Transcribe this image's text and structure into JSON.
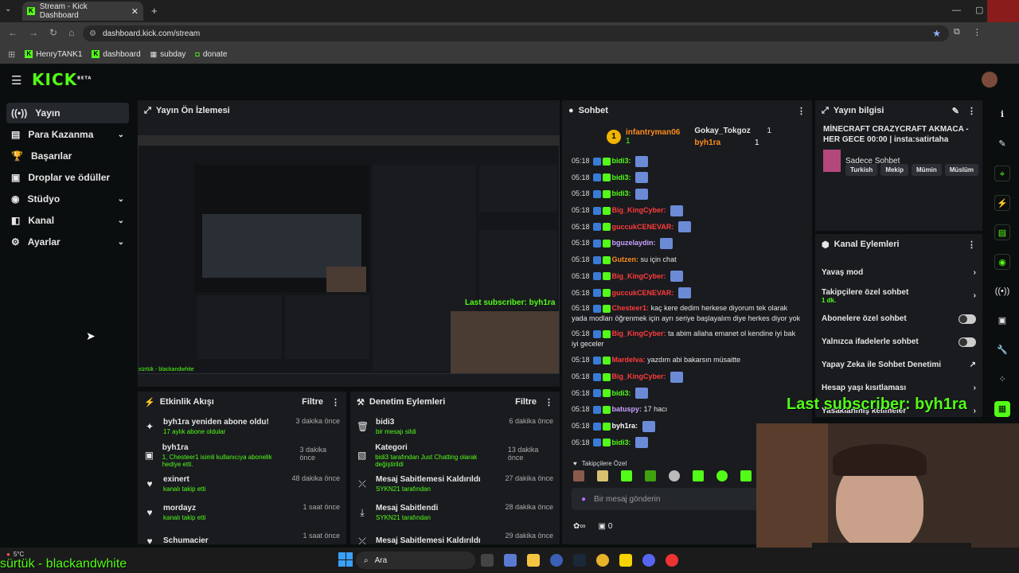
{
  "browser": {
    "tab_title": "Stream - Kick Dashboard",
    "url": "dashboard.kick.com/stream",
    "bookmarks": [
      "HenryTANK1",
      "dashboard",
      "subday",
      "donate"
    ]
  },
  "app": {
    "logo": "KICK",
    "logo_sup": "BETA"
  },
  "sidebar": {
    "items": [
      {
        "label": "Yayın",
        "icon": "live-icon",
        "chev": false
      },
      {
        "label": "Para Kazanma",
        "icon": "money-icon",
        "chev": true
      },
      {
        "label": "Başarılar",
        "icon": "trophy-icon",
        "chev": false
      },
      {
        "label": "Droplar ve ödüller",
        "icon": "gift-icon",
        "chev": false
      },
      {
        "label": "Stüdyo",
        "icon": "studio-icon",
        "chev": true
      },
      {
        "label": "Kanal",
        "icon": "channel-icon",
        "chev": true
      },
      {
        "label": "Ayarlar",
        "icon": "settings-icon",
        "chev": true
      }
    ]
  },
  "preview": {
    "title": "Yayın Ön İzlemesi",
    "overlay_sub": "Last subscriber: byh1ra",
    "overlay_bottom": "sürtük - blackandwhite"
  },
  "activity": {
    "title": "Etkinlik Akışı",
    "filter": "Filtre",
    "items": [
      {
        "icon": "resub-icon",
        "title": "byh1ra yeniden abone oldu!",
        "sub": "17 aylık abone oldular",
        "time": "3 dakika önce"
      },
      {
        "icon": "gift-sub-icon",
        "title": "byh1ra",
        "sub": "1, Chesteer1 isimli kullanıcıya abonelik hediye etti.",
        "time": "3 dakika önce"
      },
      {
        "icon": "heart-icon",
        "title": "exinert",
        "sub": "kanalı takip etti",
        "time": "48 dakika önce"
      },
      {
        "icon": "heart-icon",
        "title": "mordayz",
        "sub": "kanalı takip etti",
        "time": "1 saat önce"
      },
      {
        "icon": "heart-icon",
        "title": "Schumacier",
        "sub": "",
        "time": "1 saat önce"
      }
    ]
  },
  "moderation": {
    "title": "Denetim Eylemleri",
    "filter": "Filtre",
    "items": [
      {
        "icon": "trash-icon",
        "title": "bidi3",
        "sub": "bir mesajı sildi",
        "time": "6 dakika önce"
      },
      {
        "icon": "category-icon",
        "title": "Kategori",
        "sub": "bidi3 tarafından Just Chatting olarak değiştirildi",
        "time": "13 dakika önce"
      },
      {
        "icon": "unpin-icon",
        "title": "Mesaj Sabitlemesi Kaldırıldı",
        "sub": "SYKN21 tarafından",
        "time": "27 dakika önce"
      },
      {
        "icon": "pin-icon",
        "title": "Mesaj Sabitlendi",
        "sub": "SYKN21 tarafından",
        "time": "28 dakika önce"
      },
      {
        "icon": "unpin-icon",
        "title": "Mesaj Sabitlemesi Kaldırıldı",
        "sub": "",
        "time": "29 dakika önce"
      }
    ]
  },
  "chat": {
    "title": "Sohbet",
    "top": [
      {
        "rank": "1",
        "name": "infantryman06",
        "count": "1"
      },
      {
        "name": "Gokay_Tokgoz",
        "count": "1"
      },
      {
        "name": "byh1ra",
        "count": "1"
      }
    ],
    "messages": [
      {
        "time": "05:18",
        "user": "bidi3:",
        "color": "#53fc18",
        "text": ""
      },
      {
        "time": "05:18",
        "user": "bidi3:",
        "color": "#53fc18",
        "text": ""
      },
      {
        "time": "05:18",
        "user": "bidi3:",
        "color": "#53fc18",
        "text": ""
      },
      {
        "time": "05:18",
        "user": "Big_KingCyber:",
        "color": "#ff3b3b",
        "text": ""
      },
      {
        "time": "05:18",
        "user": "guccukCENEVAR:",
        "color": "#ff3b3b",
        "text": ""
      },
      {
        "time": "05:18",
        "user": "bguzelaydin:",
        "color": "#c9a0ff",
        "text": ""
      },
      {
        "time": "05:18",
        "user": "Gutzen:",
        "color": "#ff8c1a",
        "text": "su için chat"
      },
      {
        "time": "05:18",
        "user": "Big_KingCyber:",
        "color": "#ff3b3b",
        "text": ""
      },
      {
        "time": "05:18",
        "user": "guccukCENEVAR:",
        "color": "#ff3b3b",
        "text": ""
      },
      {
        "time": "05:18",
        "user": "Chesteer1:",
        "color": "#ff3b3b",
        "text": "kaç kere dedim herkese diyorum tek olarak yada modları öğrenmek için ayrı seriye başlayalım diye herkes diyor yok"
      },
      {
        "time": "05:18",
        "user": "Big_KingCyber:",
        "color": "#ff3b3b",
        "text": "ta abim allaha emanet ol kendine iyi bak iyi geceler"
      },
      {
        "time": "05:18",
        "user": "Mardelva:",
        "color": "#ff3b3b",
        "text": "yazdım abi bakarsın müsaitte"
      },
      {
        "time": "05:18",
        "user": "Big_KingCyber:",
        "color": "#ff3b3b",
        "text": ""
      },
      {
        "time": "05:18",
        "user": "bidi3:",
        "color": "#53fc18",
        "text": ""
      },
      {
        "time": "05:18",
        "user": "batuspy:",
        "color": "#c9a0ff",
        "text": "17 hacı"
      },
      {
        "time": "05:18",
        "user": "byh1ra:",
        "color": "#ffffff",
        "text": ""
      },
      {
        "time": "05:18",
        "user": "bidi3:",
        "color": "#53fc18",
        "text": ""
      }
    ],
    "followers_label": "Takipçilere Özel",
    "input_placeholder": "Bir mesaj gönderin",
    "count": "0"
  },
  "info": {
    "title": "Yayın bilgisi",
    "stream_title": "MİNECRAFT CRAZYCRAFT AKMACA - HER GECE 00:00 | insta:satirtaha",
    "category": "Sadece Sohbet",
    "tags": [
      "Turkish",
      "Mekip",
      "Mümin",
      "Müslüm"
    ]
  },
  "actions": {
    "title": "Kanal Eylemleri",
    "items": [
      {
        "label": "Yavaş mod",
        "type": "arrow"
      },
      {
        "label": "Takipçilere özel sohbet",
        "sub": "1 dk.",
        "type": "arrow"
      },
      {
        "label": "Abonelere özel sohbet",
        "type": "toggle"
      },
      {
        "label": "Yalnızca ifadelerle sohbet",
        "type": "toggle"
      },
      {
        "label": "Yapay Zeka ile Sohbet Denetimi",
        "type": "link"
      },
      {
        "label": "Hesap yaşı kısıtlaması",
        "type": "arrow"
      },
      {
        "label": "Yasaklanmış kelimeler",
        "type": "arrow"
      }
    ]
  },
  "overlay": {
    "last_sub": "Last subscriber: byh1ra",
    "song": "sürtük - blackandwhite"
  },
  "taskbar": {
    "search": "Ara",
    "temp": "5°C"
  }
}
